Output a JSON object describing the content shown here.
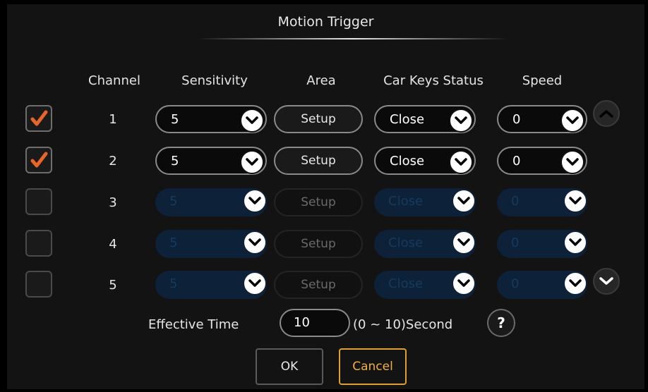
{
  "dialog": {
    "title": "Motion Trigger"
  },
  "columns": {
    "channel": "Channel",
    "sensitivity": "Sensitivity",
    "area": "Area",
    "car_keys_status": "Car Keys Status",
    "speed": "Speed"
  },
  "rows": [
    {
      "checked": true,
      "channel": "1",
      "sensitivity": "5",
      "area": "Setup",
      "car_keys_status": "Close",
      "speed": "0",
      "enabled": true
    },
    {
      "checked": true,
      "channel": "2",
      "sensitivity": "5",
      "area": "Setup",
      "car_keys_status": "Close",
      "speed": "0",
      "enabled": true
    },
    {
      "checked": false,
      "channel": "3",
      "sensitivity": "5",
      "area": "Setup",
      "car_keys_status": "Close",
      "speed": "0",
      "enabled": false
    },
    {
      "checked": false,
      "channel": "4",
      "sensitivity": "5",
      "area": "Setup",
      "car_keys_status": "Close",
      "speed": "0",
      "enabled": false
    },
    {
      "checked": false,
      "channel": "5",
      "sensitivity": "5",
      "area": "Setup",
      "car_keys_status": "Close",
      "speed": "0",
      "enabled": false
    }
  ],
  "effective_time": {
    "label": "Effective Time",
    "value": "10",
    "range": "(0 ~ 10)Second"
  },
  "help": {
    "label": "?"
  },
  "buttons": {
    "ok": "OK",
    "cancel": "Cancel"
  },
  "icons": {
    "scroll_up": "chevron-up-icon",
    "scroll_down": "chevron-down-icon",
    "check": "check-icon"
  },
  "colors": {
    "check_mark": "#e8652a",
    "cancel_accent": "#e0a030",
    "disabled_field": "#0d2138"
  }
}
